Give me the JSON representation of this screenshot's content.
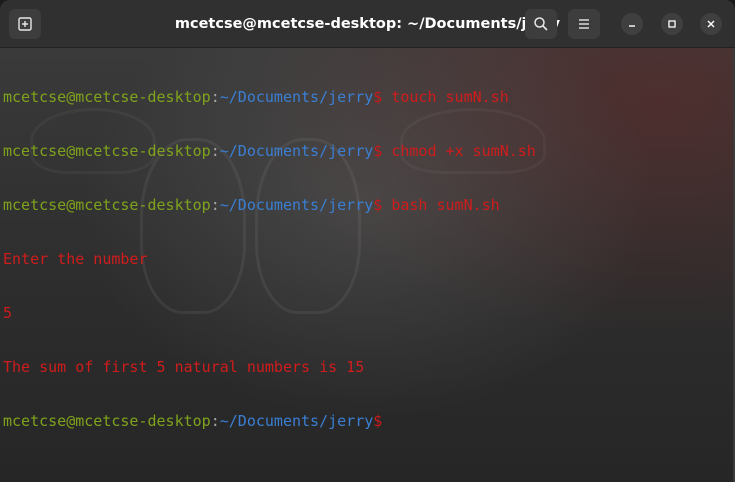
{
  "window": {
    "title": "mcetcse@mcetcse-desktop: ~/Documents/jerry"
  },
  "titlebar": {
    "new_tab_icon": "new-tab-icon",
    "search_icon": "search-icon",
    "menu_icon": "hamburger-menu-icon",
    "minimize_icon": "minimize-icon",
    "maximize_icon": "maximize-icon",
    "close_icon": "close-icon"
  },
  "terminal": {
    "lines": [
      {
        "user": "mcetcse@mcetcse-desktop",
        "colon": ":",
        "path": "~/Documents/jerry",
        "dollar": "$",
        "cmd": " touch sumN.sh"
      },
      {
        "user": "mcetcse@mcetcse-desktop",
        "colon": ":",
        "path": "~/Documents/jerry",
        "dollar": "$",
        "cmd": " chmod +x sumN.sh"
      },
      {
        "user": "mcetcse@mcetcse-desktop",
        "colon": ":",
        "path": "~/Documents/jerry",
        "dollar": "$",
        "cmd": " bash sumN.sh"
      },
      {
        "text": "Enter the number"
      },
      {
        "text": "5"
      },
      {
        "text": "The sum of first 5 natural numbers is 15"
      },
      {
        "user": "mcetcse@mcetcse-desktop",
        "colon": ":",
        "path": "~/Documents/jerry",
        "dollar": "$",
        "cmd": ""
      }
    ]
  },
  "colors": {
    "prompt_user": "#7fa31c",
    "prompt_path": "#3a7fd4",
    "output_text": "#d01c1c"
  }
}
